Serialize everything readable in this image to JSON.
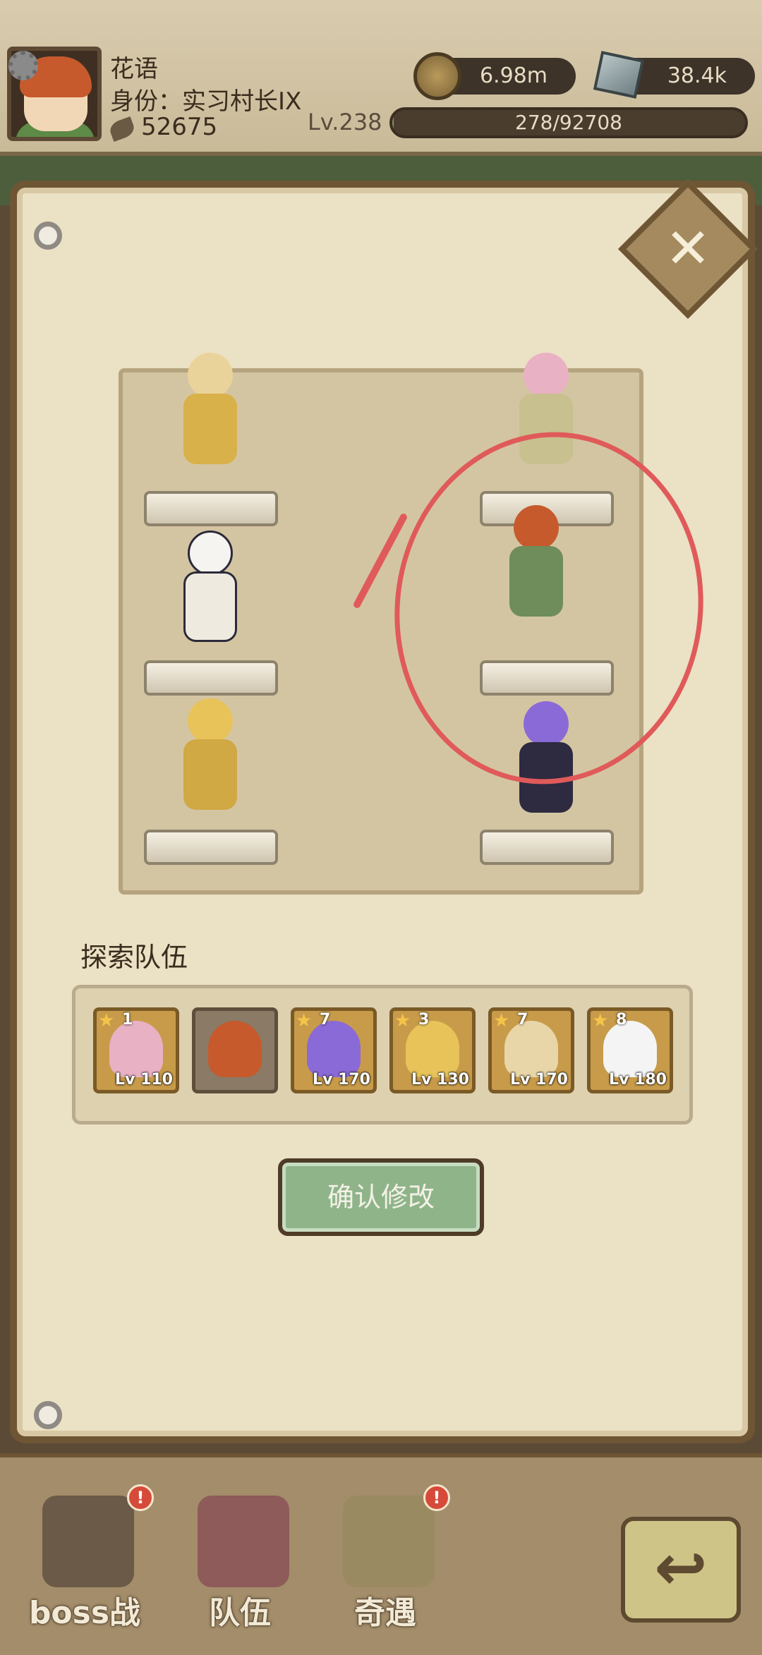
{
  "header": {
    "player_name": "花语",
    "identity": "身份：实习村长IX",
    "leaf_count": "52675",
    "level": "Lv.238",
    "exp_text": "278/92708",
    "exp_fraction": 0.003,
    "coins": "6.98m",
    "stones": "38.4k"
  },
  "formation": {
    "icons": [
      "close-icon"
    ],
    "left_column": [
      "hero-blonde-bunny",
      "hero-white-ghost",
      "hero-blonde-boy"
    ],
    "right_column": [
      "hero-pink-green-girl",
      "hero-red-archer",
      "hero-purple-octopus-girl"
    ]
  },
  "team": {
    "title": "探索队伍",
    "members": [
      {
        "stars": "1",
        "level": "Lv 110",
        "color": "#e9b1c4"
      },
      {
        "stars": "",
        "level": "",
        "color": "#c65a2c"
      },
      {
        "stars": "7",
        "level": "Lv 170",
        "color": "#8a6ad6"
      },
      {
        "stars": "3",
        "level": "Lv 130",
        "color": "#e7c35a"
      },
      {
        "stars": "7",
        "level": "Lv 170",
        "color": "#e8d6a8"
      },
      {
        "stars": "8",
        "level": "Lv 180",
        "color": "#f4f4f4"
      }
    ]
  },
  "confirm_label": "确认修改",
  "nav": {
    "boss_label": "boss战",
    "team_label": "队伍",
    "encounter_label": "奇遇",
    "badge": "!"
  }
}
